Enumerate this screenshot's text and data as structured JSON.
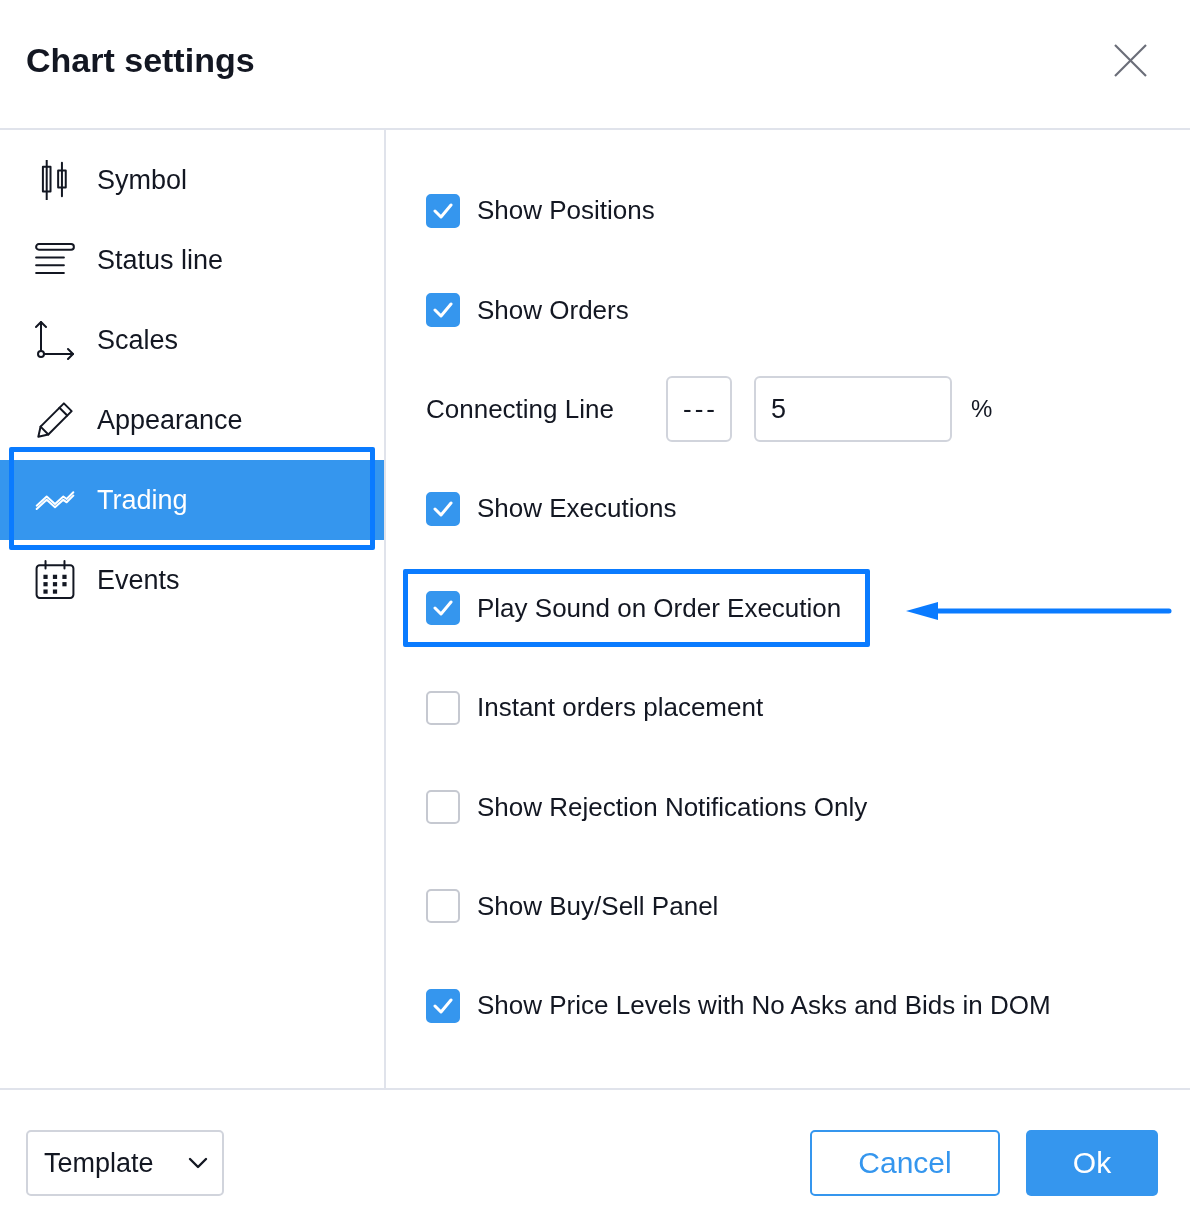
{
  "dialog": {
    "title": "Chart settings"
  },
  "sidebar": {
    "items": [
      {
        "label": "Symbol",
        "selected": false,
        "highlighted": false
      },
      {
        "label": "Status line",
        "selected": false,
        "highlighted": false
      },
      {
        "label": "Scales",
        "selected": false,
        "highlighted": false
      },
      {
        "label": "Appearance",
        "selected": false,
        "highlighted": false
      },
      {
        "label": "Trading",
        "selected": true,
        "highlighted": true
      },
      {
        "label": "Events",
        "selected": false,
        "highlighted": false
      }
    ]
  },
  "options": [
    {
      "kind": "checkbox",
      "label": "Show Positions",
      "checked": true,
      "highlighted": false
    },
    {
      "kind": "checkbox",
      "label": "Show Orders",
      "checked": true,
      "highlighted": false
    },
    {
      "kind": "connecting_line",
      "label": "Connecting Line",
      "style": "---",
      "value": "5",
      "unit": "%",
      "highlighted": false
    },
    {
      "kind": "checkbox",
      "label": "Show Executions",
      "checked": true,
      "highlighted": false
    },
    {
      "kind": "checkbox",
      "label": "Play Sound on Order Execution",
      "checked": true,
      "highlighted": true
    },
    {
      "kind": "checkbox",
      "label": "Instant orders placement",
      "checked": false,
      "highlighted": false
    },
    {
      "kind": "checkbox",
      "label": "Show Rejection Notifications Only",
      "checked": false,
      "highlighted": false
    },
    {
      "kind": "checkbox",
      "label": "Show Buy/Sell Panel",
      "checked": false,
      "highlighted": false
    },
    {
      "kind": "checkbox",
      "label": "Show Price Levels with No Asks and Bids in DOM",
      "checked": true,
      "highlighted": false
    }
  ],
  "footer": {
    "template": "Template",
    "buttons": [
      {
        "label": "Cancel",
        "kind": "secondary"
      },
      {
        "label": "Ok",
        "kind": "primary"
      }
    ]
  }
}
